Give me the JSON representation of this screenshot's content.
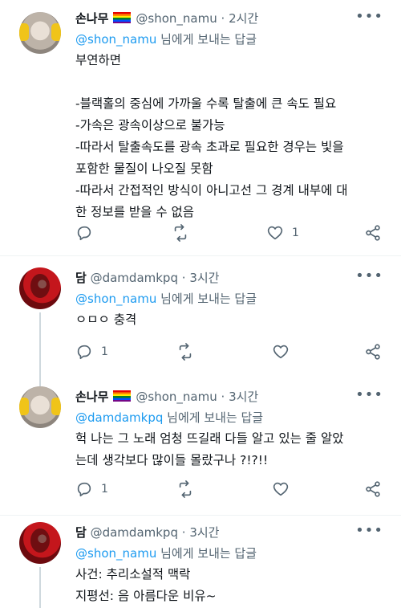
{
  "tweets": [
    {
      "name": "손나무",
      "handle": "@shon_namu",
      "dot": "·",
      "time": "2시간",
      "reply_to": "@shon_namu",
      "reply_suffix": " 님에게 보내는 답글",
      "lines": [
        "부연하면",
        "",
        "-블랙홀의 중심에 가까울 수록 탈출에 큰 속도 필요",
        "-가속은 광속이상으로 불가능",
        "-따라서 탈출속도를 광속 초과로 필요한 경우는 빛을",
        "포함한 물질이 나오질 못함",
        "-따라서 간접적인 방식이 아니고선 그 경계 내부에 대",
        "한 정보를 받을 수 없음"
      ],
      "reply_count": "",
      "like_count": "1"
    },
    {
      "name": "담",
      "handle": "@damdamkpq",
      "dot": "·",
      "time": "3시간",
      "reply_to": "@shon_namu",
      "reply_suffix": " 님에게 보내는 답글",
      "lines": [
        "ㅇㅁㅇ 충격"
      ],
      "reply_count": "1",
      "like_count": ""
    },
    {
      "name": "손나무",
      "handle": "@shon_namu",
      "dot": "·",
      "time": "3시간",
      "reply_to": "@damdamkpq",
      "reply_suffix": " 님에게 보내는 답글",
      "lines": [
        "헉 나는 그 노래 엄청 뜨길래 다들 알고 있는 줄 알았",
        "는데 생각보다 많이들 몰랐구나 ?!?!!"
      ],
      "reply_count": "1",
      "like_count": ""
    },
    {
      "name": "담",
      "handle": "@damdamkpq",
      "dot": "·",
      "time": "3시간",
      "reply_to": "@shon_namu",
      "reply_suffix": " 님에게 보내는 답글",
      "lines": [
        "사건: 추리소설적 맥락",
        "지평선: 음 아름다운 비유~"
      ],
      "reply_count": "",
      "like_count": ""
    }
  ],
  "icons": {
    "more": "more-icon",
    "reply": "reply-icon",
    "retweet": "retweet-icon",
    "like": "heart-icon",
    "share": "share-icon"
  },
  "colors": {
    "link": "#1d9bf0",
    "muted": "#536471",
    "text": "#0f1419"
  }
}
